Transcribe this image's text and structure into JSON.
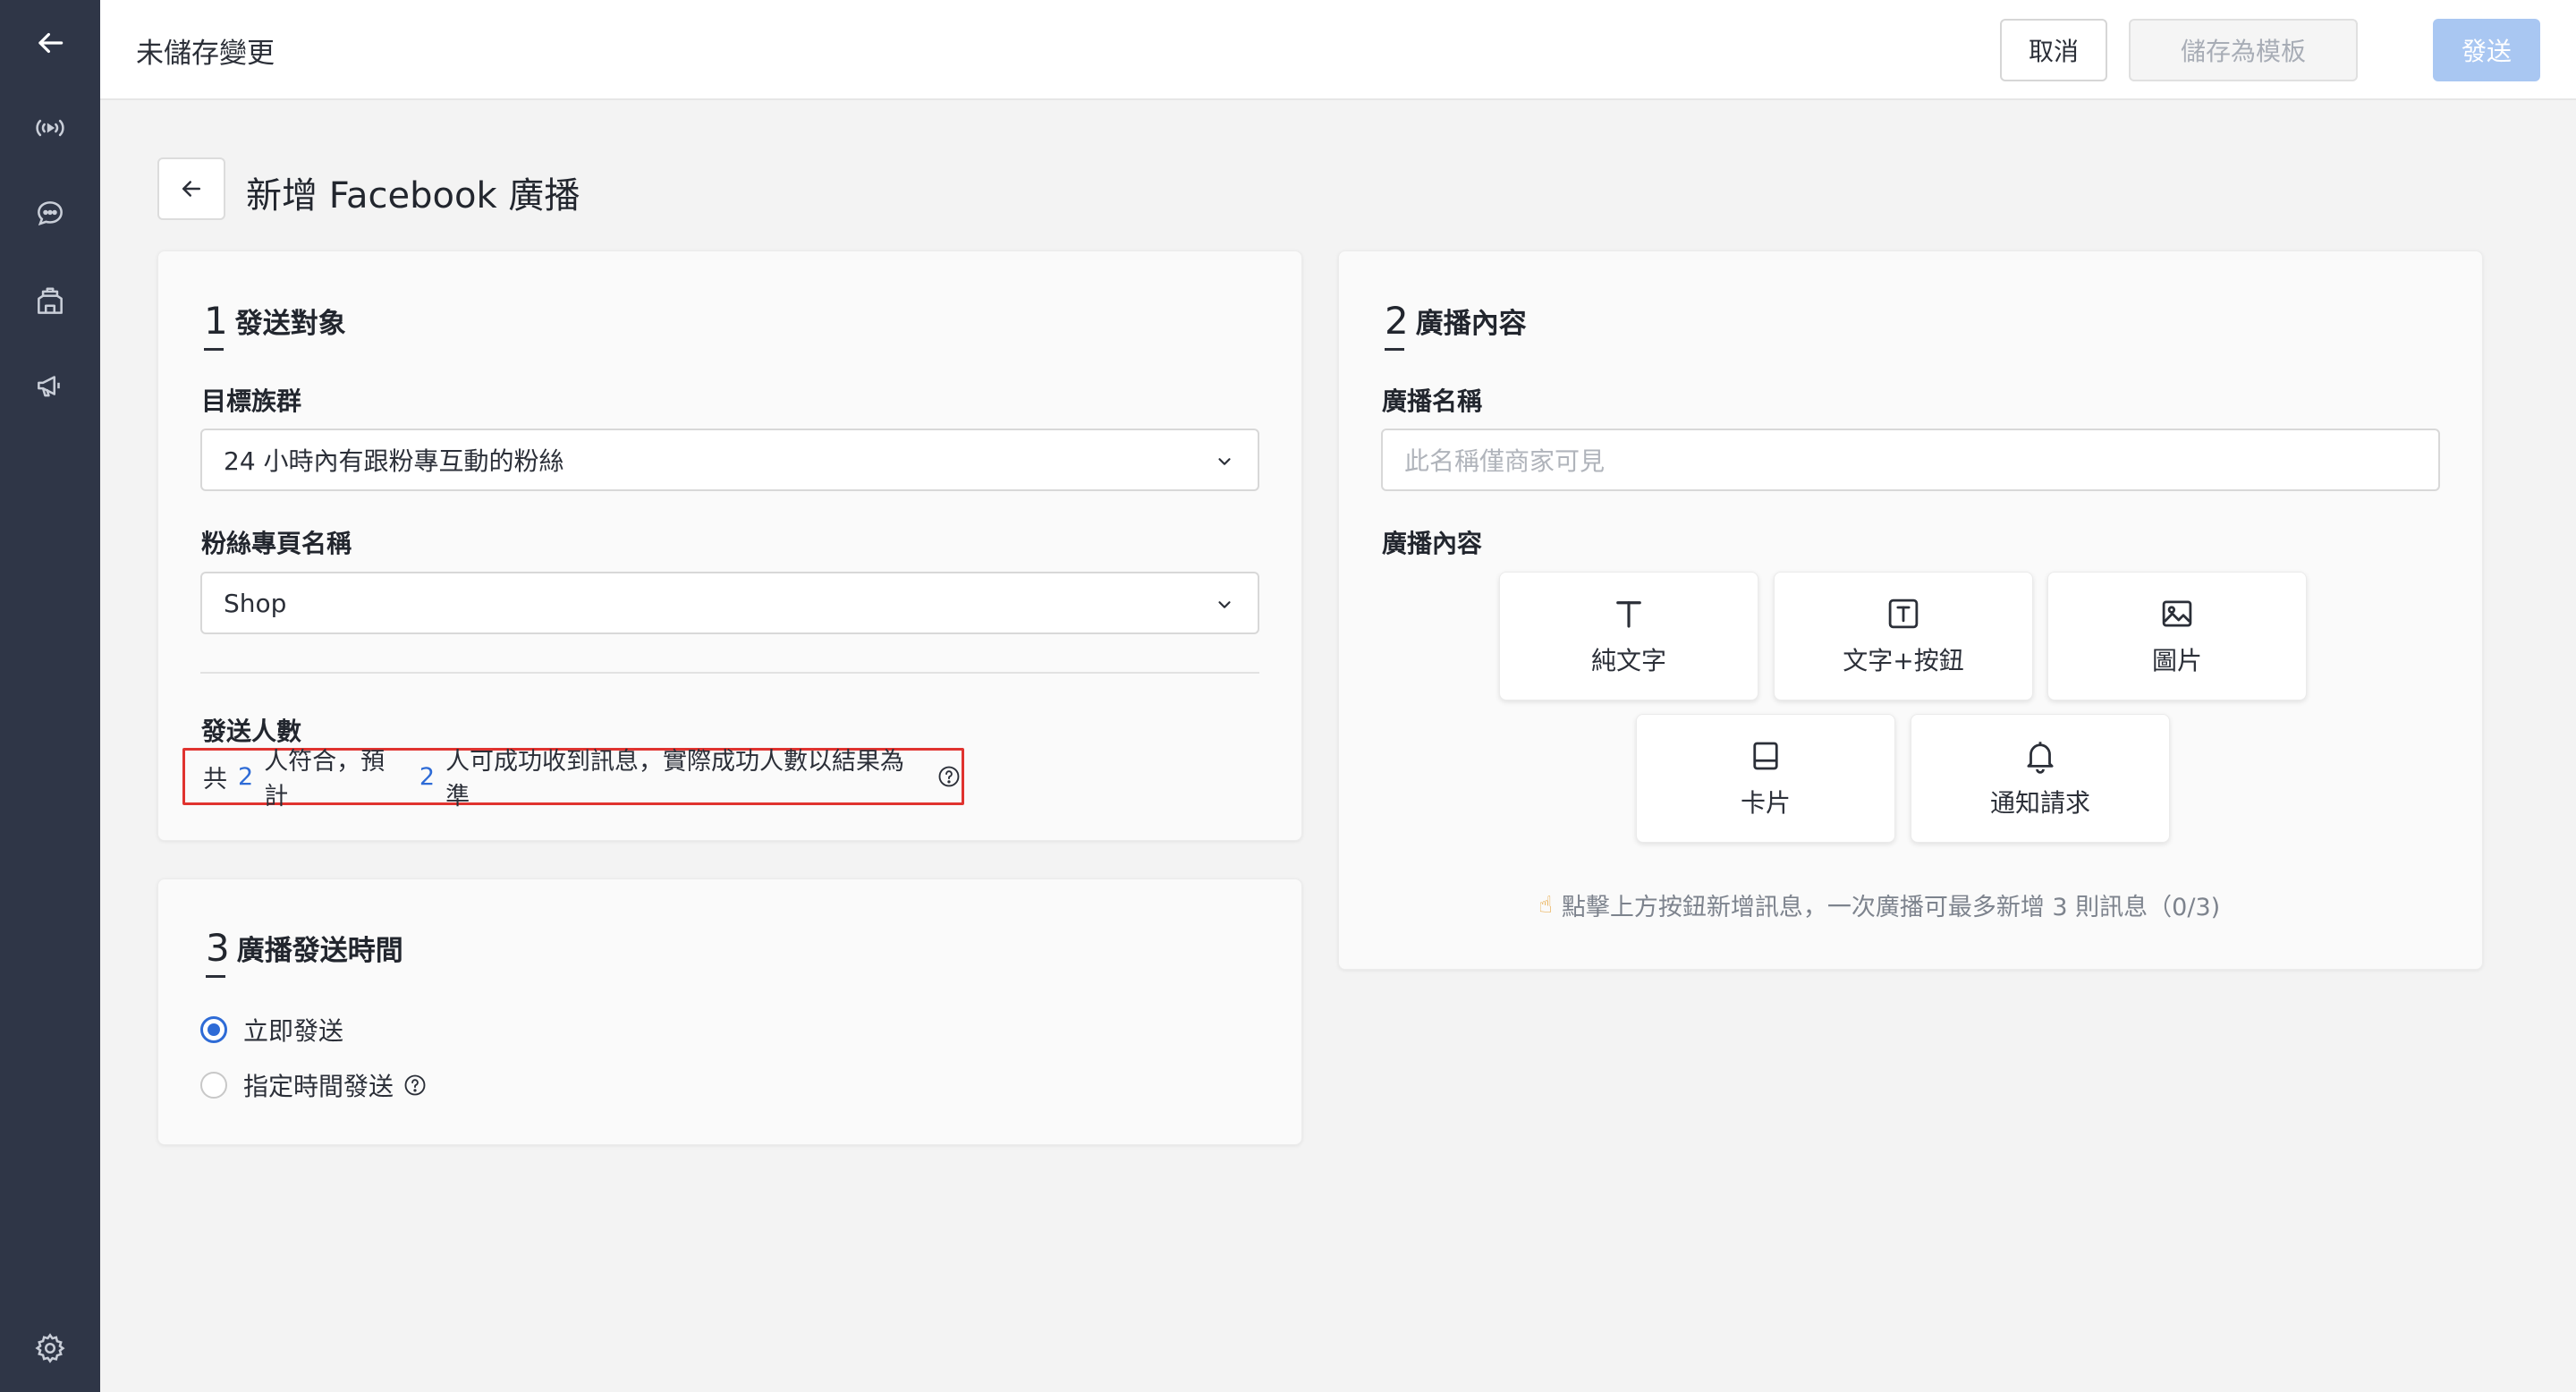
{
  "sidebar": {
    "icons": [
      "back-arrow-icon",
      "broadcast-icon",
      "chat-icon",
      "store-icon",
      "megaphone-icon",
      "gear-icon"
    ]
  },
  "topbar": {
    "status": "未儲存變更",
    "cancel_label": "取消",
    "save_template_label": "儲存為模板",
    "send_label": "發送"
  },
  "page": {
    "title": "新增 Facebook 廣播"
  },
  "section1": {
    "number": "1",
    "title": "發送對象",
    "target_label": "目標族群",
    "target_value": "24 小時內有跟粉專互動的粉絲",
    "page_label": "粉絲專頁名稱",
    "page_value": "Shop",
    "count_label": "發送人數",
    "count_prefix": "共",
    "count_matched": "2",
    "count_mid": "人符合，預計",
    "count_expected": "2",
    "count_suffix": "人可成功收到訊息，實際成功人數以結果為準"
  },
  "section2": {
    "number": "2",
    "title": "廣播內容",
    "name_label": "廣播名稱",
    "name_placeholder": "此名稱僅商家可見",
    "content_label": "廣播內容",
    "tiles": {
      "text": "純文字",
      "text_button": "文字+按鈕",
      "image": "圖片",
      "card": "卡片",
      "notify": "通知請求"
    },
    "hint": "點擊上方按鈕新增訊息，一次廣播可最多新增 3 則訊息（0/3)"
  },
  "section3": {
    "number": "3",
    "title": "廣播發送時間",
    "opt_now": "立即發送",
    "opt_scheduled": "指定時間發送",
    "selected": "立即發送"
  }
}
